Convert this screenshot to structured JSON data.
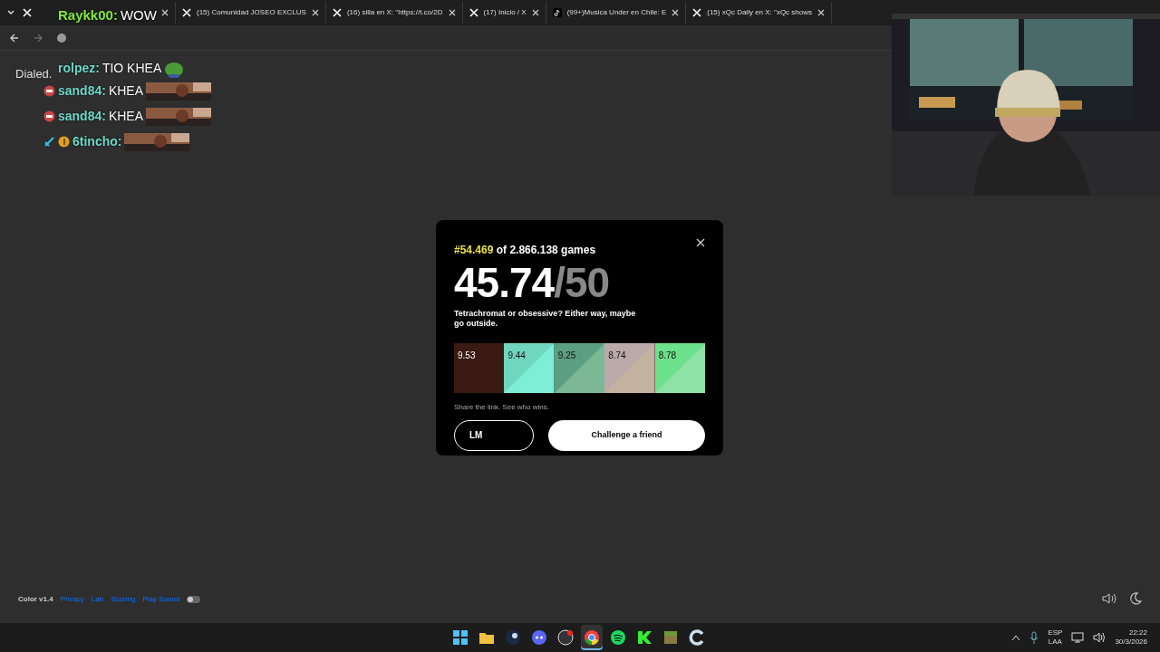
{
  "tabs": [
    {
      "kind": "x",
      "selected": false
    },
    {
      "kind": "x",
      "title": "(15) Comunidad JOSEO EXCLUS",
      "selected": false
    },
    {
      "kind": "x",
      "title": "(16) silla en X: \"https://t.co/2D",
      "selected": false
    },
    {
      "kind": "x",
      "title": "(17) Inicio / X",
      "selected": false
    },
    {
      "kind": "tiktok",
      "title": "(99+)Musica Under en Chile: E",
      "selected": false
    },
    {
      "kind": "x",
      "title": "(15) xQc Daily en X: \"xQc shows",
      "selected": false
    }
  ],
  "page": {
    "logo": "Dialed.",
    "result": {
      "rank": "#54.469",
      "rank_suffix": "of 2.866.138 games",
      "score": "45.74",
      "max": "/50",
      "comment": "Tetrachromat or obsessive? Either way, maybe go outside.",
      "swatches": [
        {
          "score": "9.53",
          "color": "#3a1a12",
          "guess": {
            "color": "#3a1a12"
          }
        },
        {
          "score": "9.44",
          "color": "#70d6c0",
          "guess": {
            "color": "#7eeed6"
          }
        },
        {
          "score": "9.25",
          "color": "#5c9e80",
          "guess": {
            "color": "#7cb896"
          }
        },
        {
          "score": "8.74",
          "color": "#bcaaaa",
          "guess": {
            "color": "#c2b29e"
          }
        },
        {
          "score": "8.78",
          "color": "#6ce08a",
          "guess": {
            "color": "#8ee2a6"
          }
        }
      ],
      "share_text": "Share the link. See who wins.",
      "name_button": "LM",
      "challenge_button": "Challenge a friend"
    },
    "footer": {
      "version": "Color v1.4",
      "links": [
        "Privacy",
        "Lab",
        "Scoring",
        "Play Sound"
      ],
      "sound_on": false
    }
  },
  "chat": [
    {
      "user": "Raykk00:",
      "color": "#7ee83c",
      "text": "WOW"
    },
    {
      "user": "rolpez:",
      "color": "#6ed6c8",
      "text": "TIO KHEA",
      "emote": {
        "kind": "blob"
      }
    },
    {
      "user": "sand84:",
      "color": "#6ed6c8",
      "text": "KHEA",
      "badges": [
        {
          "kind": "mouth"
        }
      ],
      "emote": {
        "kind": "picture"
      }
    },
    {
      "user": "sand84:",
      "color": "#6ed6c8",
      "text": "KHEA",
      "badges": [
        {
          "kind": "mouth"
        }
      ],
      "emote": {
        "kind": "picture"
      }
    },
    {
      "user": "6tincho:",
      "color": "#6ed6c8",
      "badges": [
        {
          "kind": "sword"
        },
        {
          "kind": "coin"
        }
      ],
      "emote": {
        "kind": "picture"
      }
    }
  ],
  "taskbar": {
    "apps": [
      {
        "kind": "start",
        "active": false
      },
      {
        "kind": "folder",
        "active": false
      },
      {
        "kind": "game",
        "active": false
      },
      {
        "kind": "chat",
        "active": false
      },
      {
        "kind": "record",
        "active": false
      },
      {
        "kind": "browser",
        "active": true
      },
      {
        "kind": "music",
        "active": false
      },
      {
        "kind": "greenapp",
        "active": false
      },
      {
        "kind": "block",
        "active": false
      },
      {
        "kind": "arc",
        "active": false
      }
    ],
    "language": "ESP",
    "layout": "LAA",
    "time": "22:22",
    "date": "30/3/2026"
  }
}
